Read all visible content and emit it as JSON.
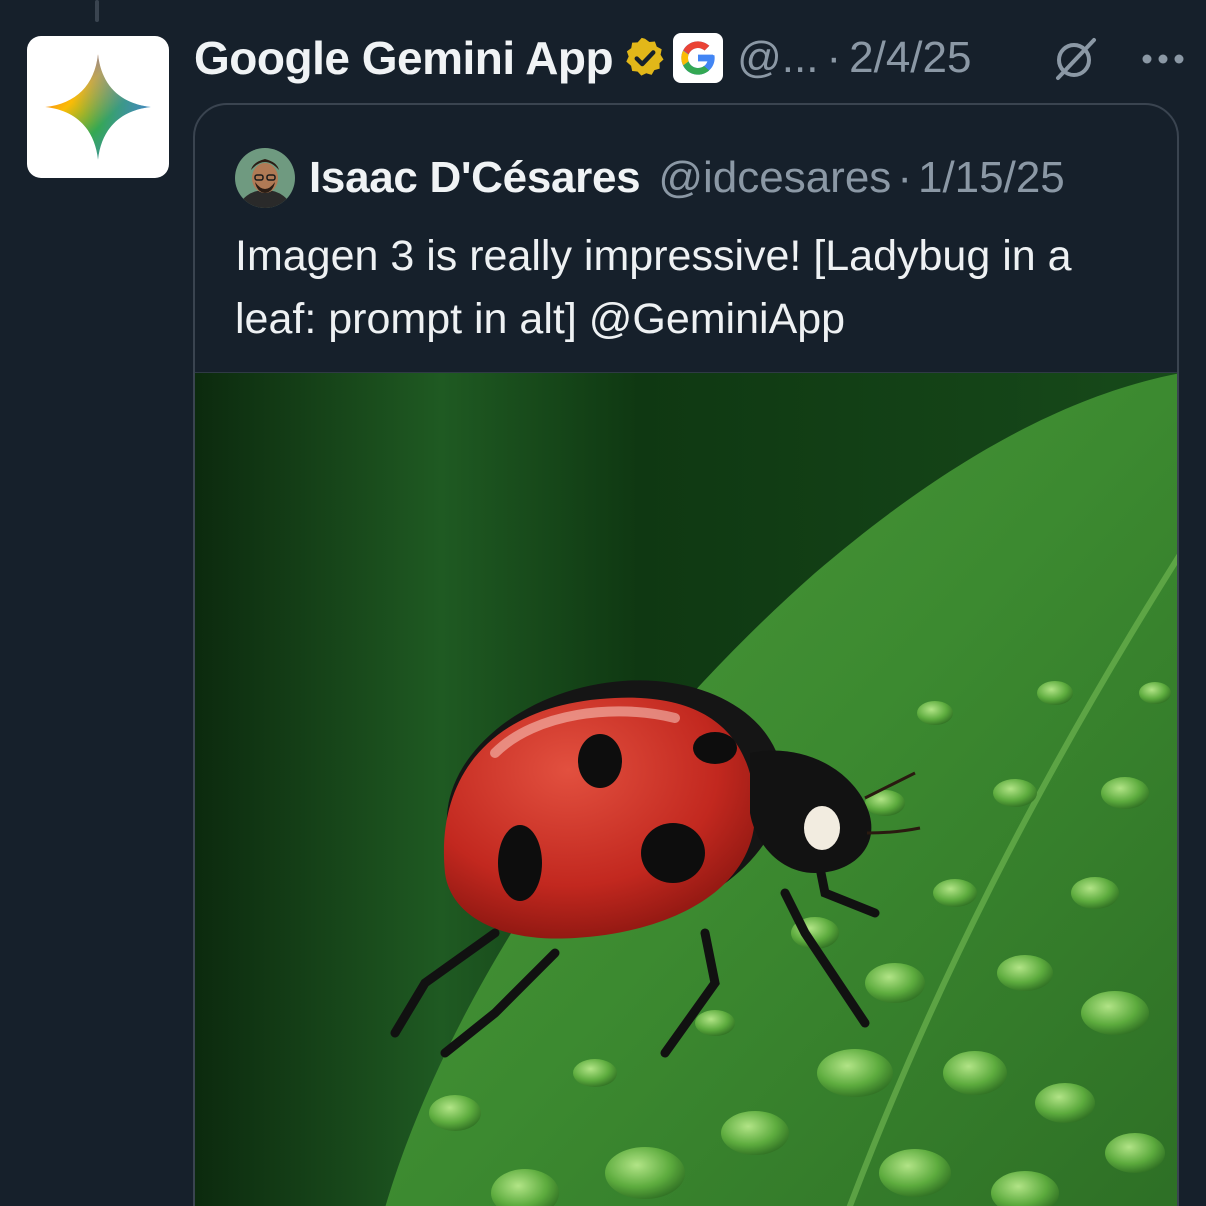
{
  "post": {
    "display_name": "Google Gemini App",
    "verified_badge_icon": "verified-badge-icon",
    "affiliate_icon": "google-g-logo-icon",
    "handle": "@...",
    "separator": "·",
    "date": "2/4/25",
    "avatar_icon": "gemini-sparkle-icon"
  },
  "quote": {
    "display_name": "Isaac D'Césares",
    "handle": "@idcesares",
    "separator": "·",
    "date": "1/15/25",
    "text": "Imagen 3 is really impressive! [Ladybug in a leaf: prompt in alt] @GeminiApp",
    "image_icon": "ladybug-on-leaf-image"
  },
  "colors": {
    "background": "#16202b",
    "primary_text": "#f0f3f5",
    "secondary_text": "#8b98a5",
    "border": "#3a4450",
    "verified_gold": "#e2b719"
  }
}
